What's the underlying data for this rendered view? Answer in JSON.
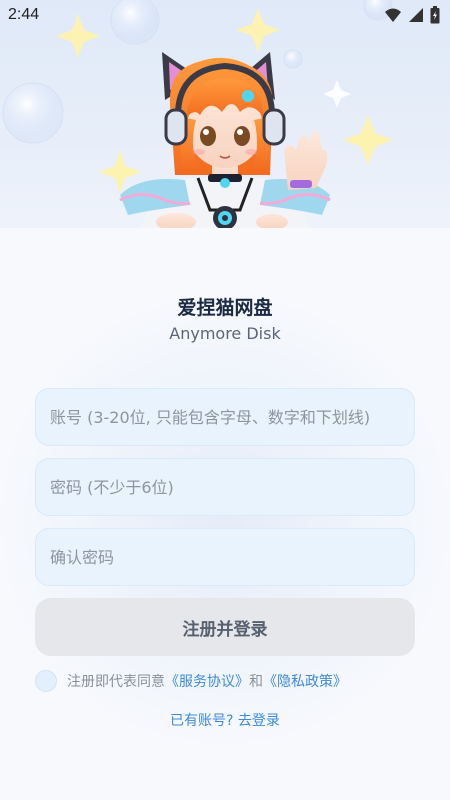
{
  "status_bar": {
    "time": "2:44"
  },
  "app": {
    "title": "爱捏猫网盘",
    "subtitle": "Anymore Disk"
  },
  "form": {
    "username_placeholder": "账号 (3-20位, 只能包含字母、数字和下划线)",
    "password_placeholder": "密码 (不少于6位)",
    "confirm_placeholder": "确认密码",
    "submit_label": "注册并登录"
  },
  "agreement": {
    "prefix": "注册即代表同意",
    "terms_link": "《服务协议》",
    "and_text": "和",
    "privacy_link": "《隐私政策》",
    "checked": false
  },
  "footer": {
    "login_link": "已有账号? 去登录"
  },
  "colors": {
    "accent": "#3d8ad8",
    "input_bg": "#e8f3fd",
    "button_bg": "#e6e7ea",
    "title": "#1d2a44"
  },
  "icons": {
    "status": [
      "wifi-icon",
      "signal-icon",
      "battery-icon"
    ],
    "hero": "anime-cat-girl-illustration"
  }
}
